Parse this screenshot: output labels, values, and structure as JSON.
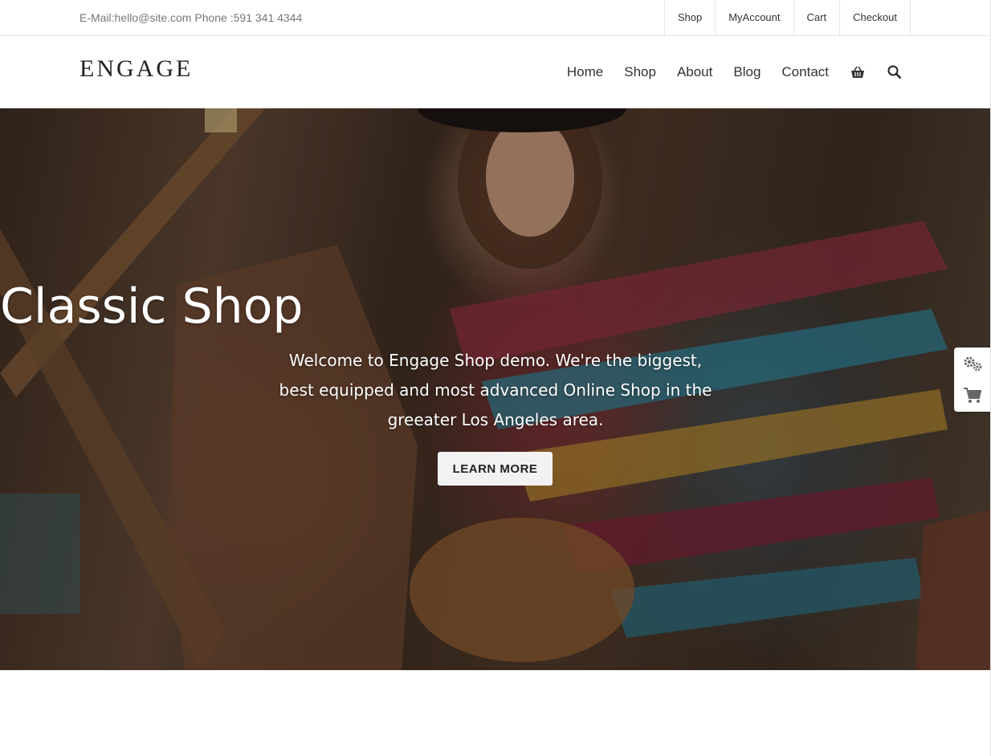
{
  "topbar": {
    "contact": "E-Mail:hello@site.com Phone :591 341 4344",
    "links": [
      "Shop",
      "MyAccount",
      "Cart",
      "Checkout"
    ]
  },
  "header": {
    "logo": "ENGAGE",
    "nav": [
      "Home",
      "Shop",
      "About",
      "Blog",
      "Contact"
    ],
    "icons": [
      "basket-icon",
      "search-icon"
    ]
  },
  "hero": {
    "title": "Classic Shop",
    "text": "Welcome to Engage Shop demo. We're the biggest, best equipped and most advanced Online Shop in the greeater Los Angeles area.",
    "button": "LEARN MORE"
  },
  "side_widget": {
    "icons": [
      "gears-icon",
      "cart-icon"
    ]
  },
  "colors": {
    "accent": "#333333",
    "button_bg": "#f2f2f2"
  }
}
